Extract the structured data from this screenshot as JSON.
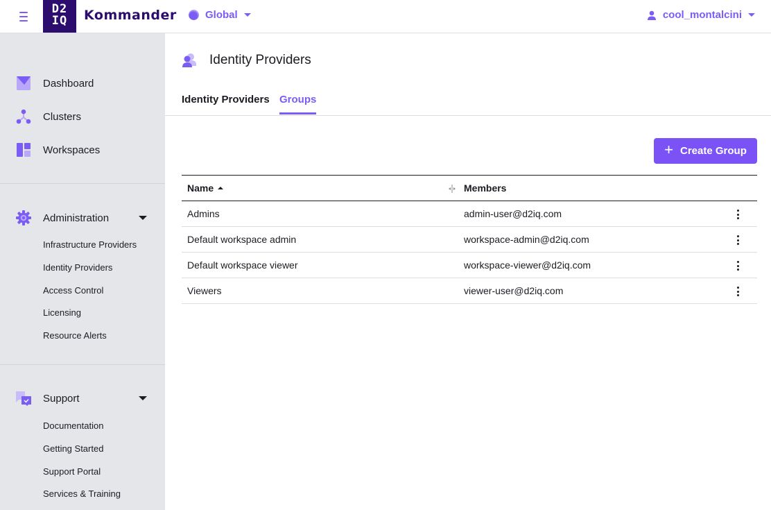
{
  "topbar": {
    "menu_icon": "hamburger-icon",
    "logo_line1": "D2",
    "logo_line2": "IQ",
    "brand": "Kommander",
    "scope_label": "Global",
    "scope_icon": "globe-dot-icon",
    "user_label": "cool_montalcini",
    "user_icon": "user-icon"
  },
  "sidebar": {
    "primary": [
      {
        "label": "Dashboard",
        "icon": "dashboard-icon"
      },
      {
        "label": "Clusters",
        "icon": "clusters-icon"
      },
      {
        "label": "Workspaces",
        "icon": "workspaces-icon"
      }
    ],
    "administration": {
      "label": "Administration",
      "icon": "gear-icon",
      "items": [
        "Infrastructure Providers",
        "Identity Providers",
        "Access Control",
        "Licensing",
        "Resource Alerts"
      ]
    },
    "support": {
      "label": "Support",
      "icon": "support-icon",
      "items": [
        "Documentation",
        "Getting Started",
        "Support Portal",
        "Services & Training"
      ]
    }
  },
  "page": {
    "title": "Identity Providers",
    "icon": "identity-providers-icon",
    "tabs": [
      {
        "label": "Identity Providers",
        "active": false
      },
      {
        "label": "Groups",
        "active": true
      }
    ],
    "create_button": "Create Group"
  },
  "table": {
    "columns": [
      {
        "label": "Name",
        "sort": "ascending"
      },
      {
        "label": "Members"
      }
    ],
    "rows": [
      {
        "name": "Admins",
        "members": "admin-user@d2iq.com"
      },
      {
        "name": "Default workspace admin",
        "members": "workspace-admin@d2iq.com"
      },
      {
        "name": "Default workspace viewer",
        "members": "workspace-viewer@d2iq.com"
      },
      {
        "name": "Viewers",
        "members": "viewer-user@d2iq.com"
      }
    ]
  },
  "colors": {
    "accent": "#7b5cf5",
    "brand_dark": "#2c0d6e",
    "sidebar_bg": "#e5e6ea",
    "button": "#7b52f6"
  }
}
